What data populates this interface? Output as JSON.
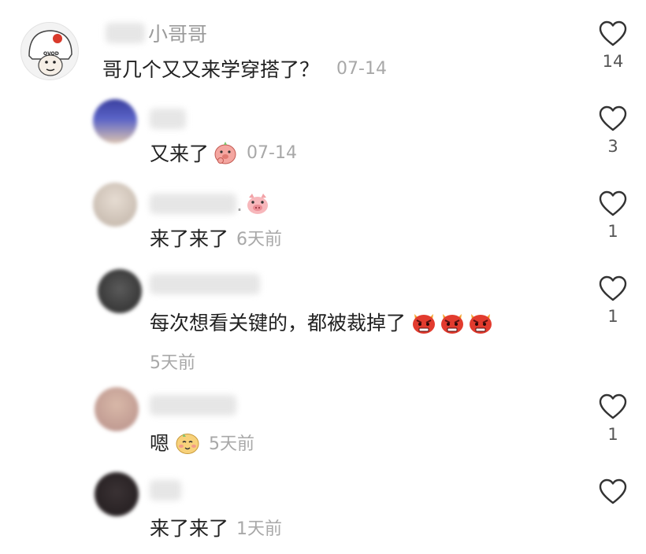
{
  "comments": [
    {
      "username_visible": "小哥哥",
      "text": "哥几个又又来学穿搭了？",
      "time": "07-14",
      "likes": "14",
      "avatar_badge": "QVOD"
    },
    {
      "username_visible": "",
      "text": "又来了",
      "time": "07-14",
      "likes": "3",
      "emoji": "thinking-pig-emoji"
    },
    {
      "username_visible": ".",
      "text": "来了来了",
      "time": "6天前",
      "likes": "1",
      "name_emoji": "pig-face-emoji"
    },
    {
      "username_visible": "",
      "text": "每次想看关键的，都被裁掉了",
      "time": "5天前",
      "likes": "1",
      "emoji": "angry-devil-emoji"
    },
    {
      "username_visible": "",
      "text": "嗯",
      "time": "5天前",
      "likes": "1",
      "emoji": "shy-face-emoji"
    },
    {
      "username_visible": "",
      "text": "来了来了",
      "time": "1天前",
      "likes": ""
    }
  ],
  "colors": {
    "text": "#222222",
    "muted": "#a8a8a8",
    "like_outline": "#333333"
  }
}
